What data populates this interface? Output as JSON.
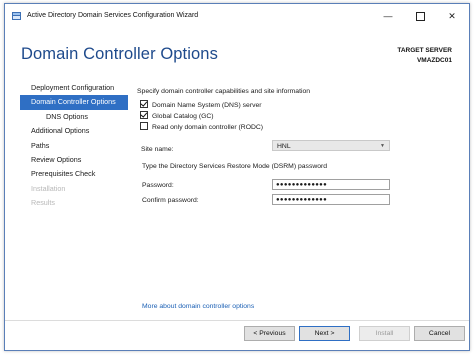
{
  "window": {
    "title": "Active Directory Domain Services Configuration Wizard"
  },
  "header": {
    "heading": "Domain Controller Options",
    "target_label": "TARGET SERVER",
    "target_name": "VMAZDC01"
  },
  "nav": {
    "items": [
      {
        "label": "Deployment Configuration",
        "state": "normal"
      },
      {
        "label": "Domain Controller Options",
        "state": "active"
      },
      {
        "label": "DNS Options",
        "state": "sub"
      },
      {
        "label": "Additional Options",
        "state": "normal"
      },
      {
        "label": "Paths",
        "state": "normal"
      },
      {
        "label": "Review Options",
        "state": "normal"
      },
      {
        "label": "Prerequisites Check",
        "state": "normal"
      },
      {
        "label": "Installation",
        "state": "disabled"
      },
      {
        "label": "Results",
        "state": "disabled"
      }
    ]
  },
  "main": {
    "intro": "Specify domain controller capabilities and site information",
    "checkboxes": [
      {
        "label": "Domain Name System (DNS) server",
        "checked": true
      },
      {
        "label": "Global Catalog (GC)",
        "checked": true
      },
      {
        "label": "Read only domain controller (RODC)",
        "checked": false
      }
    ],
    "site_label": "Site name:",
    "site_value": "HNL",
    "dsrm_heading": "Type the Directory Services Restore Mode (DSRM) password",
    "password_label": "Password:",
    "password_value": "●●●●●●●●●●●●●",
    "confirm_label": "Confirm password:",
    "confirm_value": "●●●●●●●●●●●●●",
    "more_link": "More about domain controller options"
  },
  "footer": {
    "previous": "< Previous",
    "next": "Next >",
    "install": "Install",
    "cancel": "Cancel"
  },
  "colors": {
    "accent": "#2f6fc4",
    "heading": "#1e4a8c",
    "link": "#1a5fb4"
  }
}
